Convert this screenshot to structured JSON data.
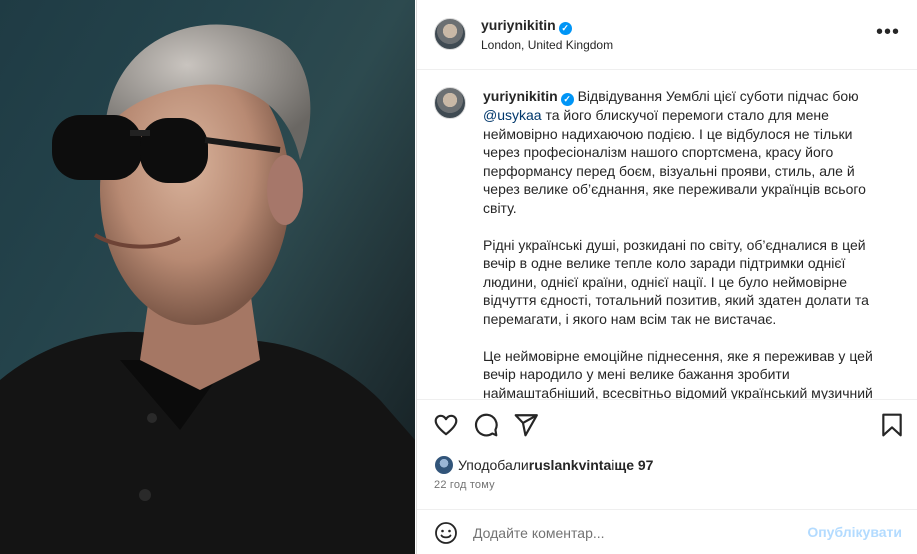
{
  "header": {
    "username": "yuriynikitin",
    "location": "London, United Kingdom",
    "more_label": "•••"
  },
  "caption": {
    "username": "yuriynikitin",
    "p1_before": " Відвідування Уемблі цієї суботи підчас бою ",
    "mention": "@usykaa",
    "p1_after": " та його блискучої перемоги стало для мене неймовірно надихаючою подією. І це відбулося не тільки через професіоналізм нашого спортсмена, красу його перформансу перед боєм, візуальні прояви, стиль, але й через велике об’єднання, яке переживали українців всього світу.",
    "p2": "Рідні українські душі, розкидані по світу, об’єдналися в цей вечір в одне велике тепле коло заради підтримки однієї людини, однієї країни, однієї нації. І це було неймовірне відчуття єдності, тотальний позитив, який здатен долати та перемагати, і якого нам всім так не вистачає.",
    "p3": "Це неймовірне емоційне піднесення, яке я переживав у цей вечір народило у мені велике бажання зробити наймаштабніший, всесвітньо відомий український музичний"
  },
  "actions": {
    "like_icon": "heart-icon",
    "comment_icon": "comment-icon",
    "share_icon": "paper-plane-icon",
    "save_icon": "bookmark-icon"
  },
  "likes": {
    "prefix": "Уподобали ",
    "user": "ruslankvinta",
    "middle": " і ",
    "others": "ще 97"
  },
  "time_ago": "22 год тому",
  "comment": {
    "placeholder": "Додайте коментар...",
    "post_label": "Опублікувати"
  },
  "colors": {
    "verified": "#0095f6",
    "post_button_disabled": "#b3dbff",
    "mention": "#00376b"
  }
}
